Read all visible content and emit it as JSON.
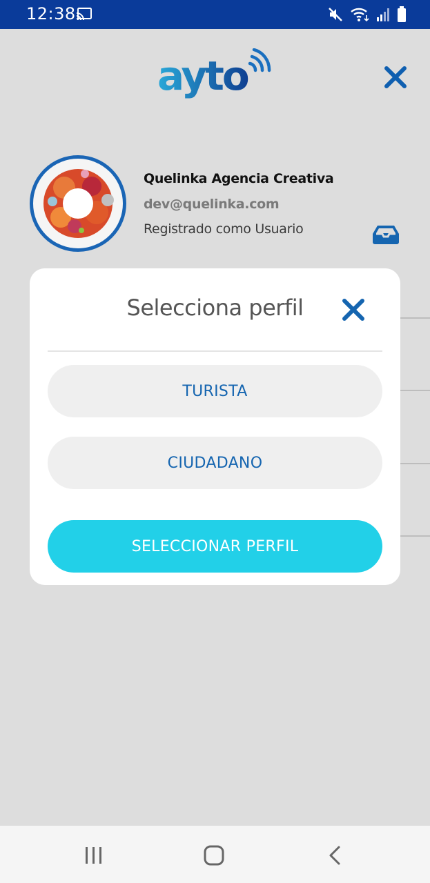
{
  "status_bar": {
    "time": "12:38",
    "icons": [
      "cast-icon",
      "mute-icon",
      "wifi-icon",
      "signal-icon",
      "battery-icon"
    ]
  },
  "header": {
    "logo_text": "ayto",
    "close_icon": "close-icon"
  },
  "profile": {
    "name": "Quelinka Agencia Creativa",
    "email": "dev@quelinka.com",
    "role": "Registrado como Usuario",
    "inbox_icon": "inbox-icon"
  },
  "modal": {
    "title": "Selecciona perfil",
    "options": [
      {
        "label": "TURISTA"
      },
      {
        "label": "CIUDADANO"
      }
    ],
    "submit_label": "SELECCIONAR PERFIL"
  },
  "nav_bar": {
    "icons": [
      "recent-apps-icon",
      "home-icon",
      "back-icon"
    ]
  },
  "colors": {
    "status_bar": "#0a3b9a",
    "accent_blue": "#1565b0",
    "primary_button": "#22d0e8",
    "overlay_background": "#dddddd"
  }
}
